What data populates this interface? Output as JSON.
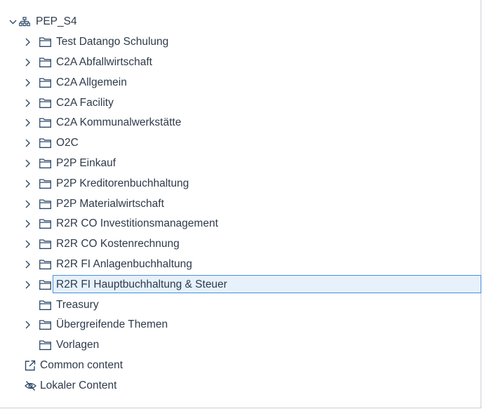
{
  "tree": {
    "root": {
      "label": "PEP_S4",
      "icon": "hierarchy-icon",
      "expanded": true
    },
    "folders": [
      {
        "label": "Test Datango Schulung",
        "expandable": true
      },
      {
        "label": "C2A Abfallwirtschaft",
        "expandable": true
      },
      {
        "label": "C2A Allgemein",
        "expandable": true
      },
      {
        "label": "C2A Facility",
        "expandable": true
      },
      {
        "label": "C2A Kommunalwerkstätte",
        "expandable": true
      },
      {
        "label": "O2C",
        "expandable": true
      },
      {
        "label": "P2P Einkauf",
        "expandable": true
      },
      {
        "label": "P2P Kreditorenbuchhaltung",
        "expandable": true
      },
      {
        "label": "P2P Materialwirtschaft",
        "expandable": true
      },
      {
        "label": "R2R CO Investitionsmanagement",
        "expandable": true
      },
      {
        "label": "R2R CO Kostenrechnung",
        "expandable": true
      },
      {
        "label": "R2R FI Anlagenbuchhaltung",
        "expandable": true
      },
      {
        "label": "R2R FI Hauptbuchhaltung & Steuer",
        "expandable": true,
        "selected": true
      },
      {
        "label": "Treasury",
        "expandable": false
      },
      {
        "label": "Übergreifende Themen",
        "expandable": true
      },
      {
        "label": "Vorlagen",
        "expandable": false
      }
    ],
    "extras": [
      {
        "label": "Common content",
        "icon": "external-link-icon"
      },
      {
        "label": "Lokaler Content",
        "icon": "eye-slash-icon"
      }
    ]
  },
  "colors": {
    "text": "#2e3a4a",
    "icon": "#2e4a6a",
    "selection_bg": "#e6f1fc",
    "selection_border": "#4a8fd7"
  }
}
